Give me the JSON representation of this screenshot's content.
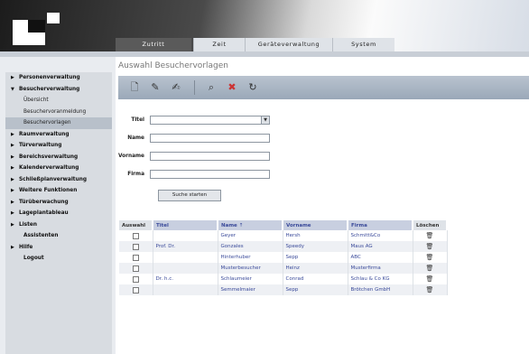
{
  "header": {
    "tabs": [
      {
        "label": "Zutritt",
        "active": true
      },
      {
        "label": "Zeit",
        "active": false
      },
      {
        "label": "Geräteverwaltung",
        "active": false
      },
      {
        "label": "System",
        "active": false
      }
    ]
  },
  "sidebar": {
    "items": [
      {
        "label": "Personenverwaltung"
      },
      {
        "label": "Besucherverwaltung"
      },
      {
        "label": "Übersicht"
      },
      {
        "label": "Besuchervoranmeldung"
      },
      {
        "label": "Besuchervorlagen"
      },
      {
        "label": "Raumverwaltung"
      },
      {
        "label": "Türverwaltung"
      },
      {
        "label": "Bereichsverwaltung"
      },
      {
        "label": "Kalenderverwaltung"
      },
      {
        "label": "Schließplanverwaltung"
      },
      {
        "label": "Weitere Funktionen"
      },
      {
        "label": "Türüberwachung"
      },
      {
        "label": "Lageplantableau"
      },
      {
        "label": "Listen"
      },
      {
        "label": "Assistenten"
      },
      {
        "label": "Hilfe"
      },
      {
        "label": "Logout"
      }
    ]
  },
  "main": {
    "title": "Auswahl Besuchervorlagen",
    "toolbar_icons": [
      "new-icon",
      "edit-icon",
      "edit-multiple-icon",
      "search-icon",
      "delete-icon",
      "refresh-icon"
    ],
    "form": {
      "labels": {
        "titel": "Titel",
        "name": "Name",
        "vorname": "Vorname",
        "firma": "Firma"
      },
      "values": {
        "titel": "",
        "name": "",
        "vorname": "",
        "firma": ""
      },
      "search_button": "Suche starten"
    },
    "table": {
      "headers": {
        "auswahl": "Auswahl",
        "titel": "Titel",
        "name": "Name ⇡",
        "vorname": "Vorname",
        "firma": "Firma",
        "loeschen": "Löschen"
      },
      "rows": [
        {
          "titel": "",
          "name": "Geyer",
          "vorname": "Hersh",
          "firma": "Schmitt&Co"
        },
        {
          "titel": "Prof. Dr.",
          "name": "Gonzales",
          "vorname": "Speedy",
          "firma": "Maus AG"
        },
        {
          "titel": "",
          "name": "Hinterhuber",
          "vorname": "Sepp",
          "firma": "ABC"
        },
        {
          "titel": "",
          "name": "Musterbesucher",
          "vorname": "Heinz",
          "firma": "Musterfirma"
        },
        {
          "titel": "Dr. h.c.",
          "name": "Schlaumeier",
          "vorname": "Conrad",
          "firma": "Schlau & Co KG"
        },
        {
          "titel": "",
          "name": "Semmelmaier",
          "vorname": "Sepp",
          "firma": "Brötchen GmbH"
        }
      ]
    }
  }
}
